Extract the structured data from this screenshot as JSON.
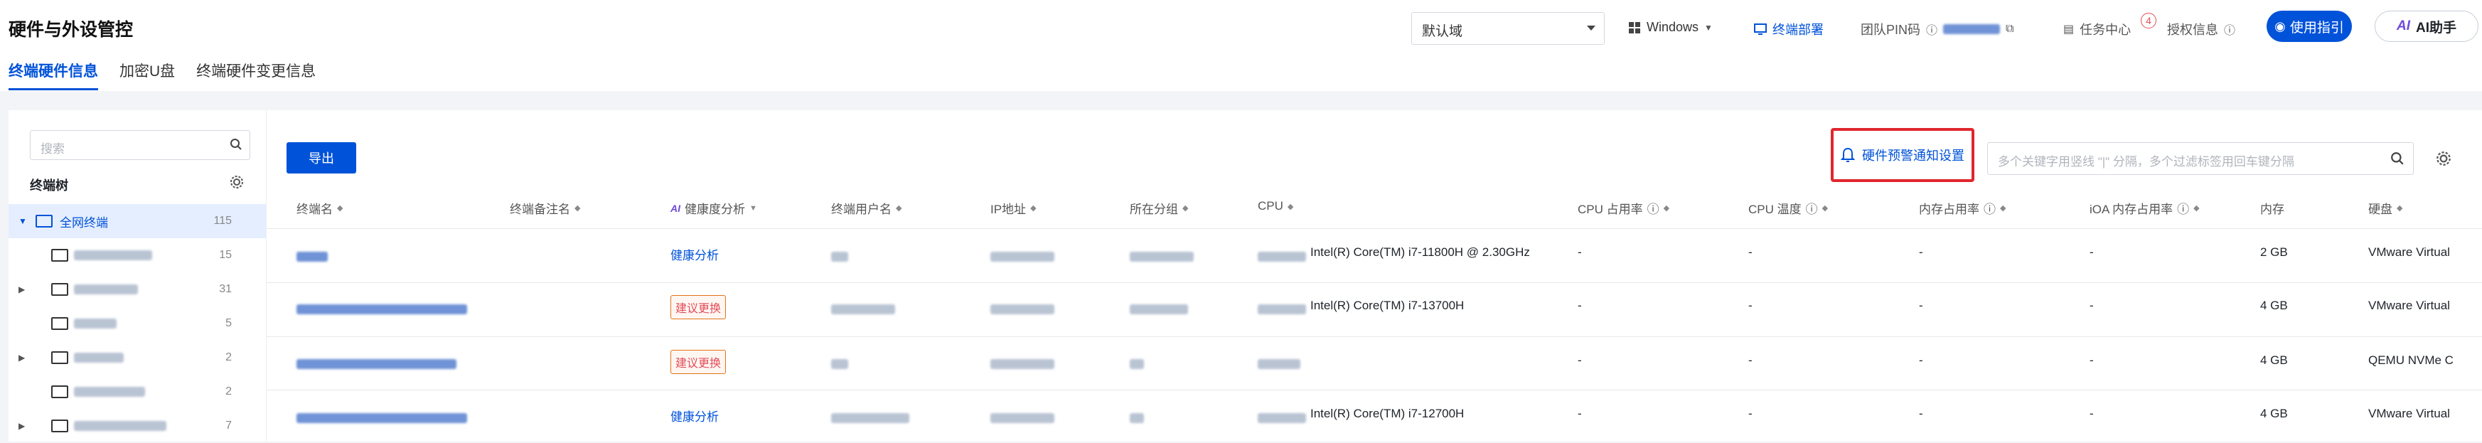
{
  "page_title": "硬件与外设管控",
  "top": {
    "domain_select": "默认域",
    "os_select": "Windows",
    "deploy_label": "终端部署",
    "pin_label": "团队PIN码",
    "task_center": "任务中心",
    "task_badge": "4",
    "license_info": "授权信息",
    "guide_button": "使用指引",
    "ai_button": "AI助手"
  },
  "tabs": [
    "终端硬件信息",
    "加密U盘",
    "终端硬件变更信息"
  ],
  "tree": {
    "search_placeholder": "搜索",
    "title": "终端树",
    "root_label": "全网终端",
    "root_count": "115",
    "child_counts": [
      "15",
      "31",
      "5",
      "2",
      "2",
      "7"
    ]
  },
  "toolbar": {
    "export": "导出",
    "notify": "硬件预警通知设置",
    "search_placeholder": "多个关键字用竖线 \"|\" 分隔，多个过滤标签用回车键分隔"
  },
  "columns": [
    "终端名",
    "终端备注名",
    "健康度分析",
    "终端用户名",
    "IP地址",
    "所在分组",
    "CPU",
    "CPU 占用率",
    "CPU 温度",
    "内存占用率",
    "iOA 内存占用率",
    "内存",
    "硬盘"
  ],
  "rows": [
    {
      "health": "健康分析",
      "cpu": "Intel(R) Core(TM) i7-11800H @ 2.30GHz",
      "cpu_usage": "-",
      "cpu_temp": "-",
      "mem_usage": "-",
      "ioa_mem": "-",
      "memory": "2 GB",
      "disk": "VMware Virtual"
    },
    {
      "health": "建议更换",
      "cpu": "Intel(R) Core(TM) i7-13700H",
      "cpu_usage": "-",
      "cpu_temp": "-",
      "mem_usage": "-",
      "ioa_mem": "-",
      "memory": "4 GB",
      "disk": "VMware Virtual"
    },
    {
      "health": "建议更换",
      "cpu": "",
      "cpu_usage": "-",
      "cpu_temp": "-",
      "mem_usage": "-",
      "ioa_mem": "-",
      "memory": "4 GB",
      "disk": "QEMU NVMe C"
    },
    {
      "health": "健康分析",
      "cpu": "Intel(R) Core(TM) i7-12700H",
      "cpu_usage": "-",
      "cpu_temp": "-",
      "mem_usage": "-",
      "ioa_mem": "-",
      "memory": "4 GB",
      "disk": "VMware Virtual"
    }
  ]
}
